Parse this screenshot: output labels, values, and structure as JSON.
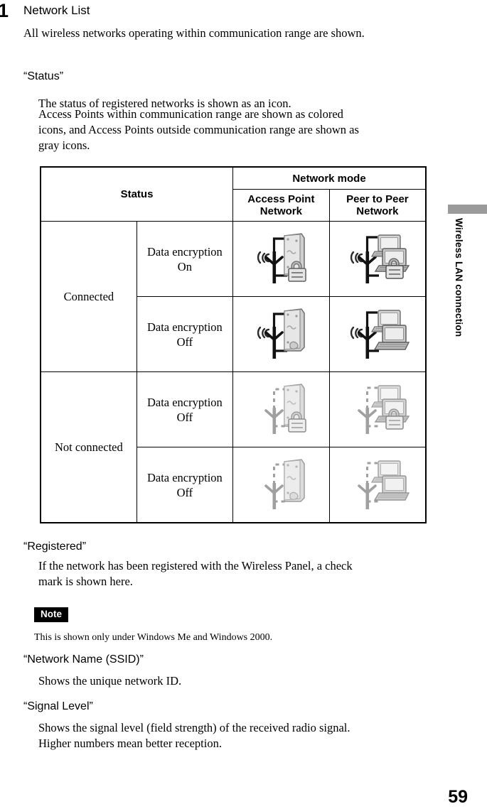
{
  "page": {
    "number": "59",
    "side_tab_label": "Wireless LAN connection"
  },
  "step": {
    "number": "1",
    "title": "Network List",
    "intro": "All wireless networks operating within communication range are shown."
  },
  "sections": [
    {
      "heading": "“Status”",
      "lines": [
        "The status of registered networks is shown as an icon.",
        "Access Points within communication range are shown as colored",
        "icons, and Access Points outside communication range are shown as",
        "gray icons."
      ]
    },
    {
      "heading": "“Registered”",
      "lines": [
        "If the network has been registered with the Wireless Panel, a check",
        "mark is shown here."
      ]
    },
    {
      "heading": "“Network Name (SSID)”",
      "lines": [
        "Shows the unique network ID."
      ]
    },
    {
      "heading": "“Signal Level”",
      "lines": [
        "Shows the signal level (field strength) of the received radio signal.",
        "Higher numbers mean better reception."
      ]
    }
  ],
  "note": {
    "label": "Note",
    "text": "This is shown only under Windows Me and Windows 2000."
  },
  "table": {
    "header": {
      "status": "Status",
      "network_mode": "Network mode",
      "access_point": "Access Point Network",
      "access_point_line1": "Access Point",
      "access_point_line2": "Network",
      "peer_to_peer": "Peer to Peer Network",
      "peer_to_peer_line1": "Peer to Peer",
      "peer_to_peer_line2": "Network"
    },
    "rows": [
      {
        "status": "Connected",
        "encryption_line1": "Data encryption",
        "encryption_line2": "On",
        "ap_icon": "access-point-connected-encrypted-icon",
        "p2p_icon": "peer-to-peer-connected-encrypted-icon"
      },
      {
        "status": "Connected",
        "encryption_line1": "Data encryption",
        "encryption_line2": "Off",
        "ap_icon": "access-point-connected-open-icon",
        "p2p_icon": "peer-to-peer-connected-open-icon"
      },
      {
        "status": "Not connected",
        "encryption_line1": "Data encryption",
        "encryption_line2": "Off",
        "ap_icon": "access-point-disconnected-encrypted-icon",
        "p2p_icon": "peer-to-peer-disconnected-encrypted-icon"
      },
      {
        "status": "Not connected",
        "encryption_line1": "Data encryption",
        "encryption_line2": "Off",
        "ap_icon": "access-point-disconnected-open-icon",
        "p2p_icon": "peer-to-peer-disconnected-open-icon"
      }
    ]
  },
  "colors": {
    "side_tab_bar": "#9a9a9a",
    "note_badge_bg": "#000000",
    "icon_active_dark": "#1a1a1a",
    "icon_active_body": "#d8d8d8",
    "icon_gray": "#9b9b9b",
    "icon_gray_body": "#dcdcdc",
    "table_border": "#000000"
  }
}
